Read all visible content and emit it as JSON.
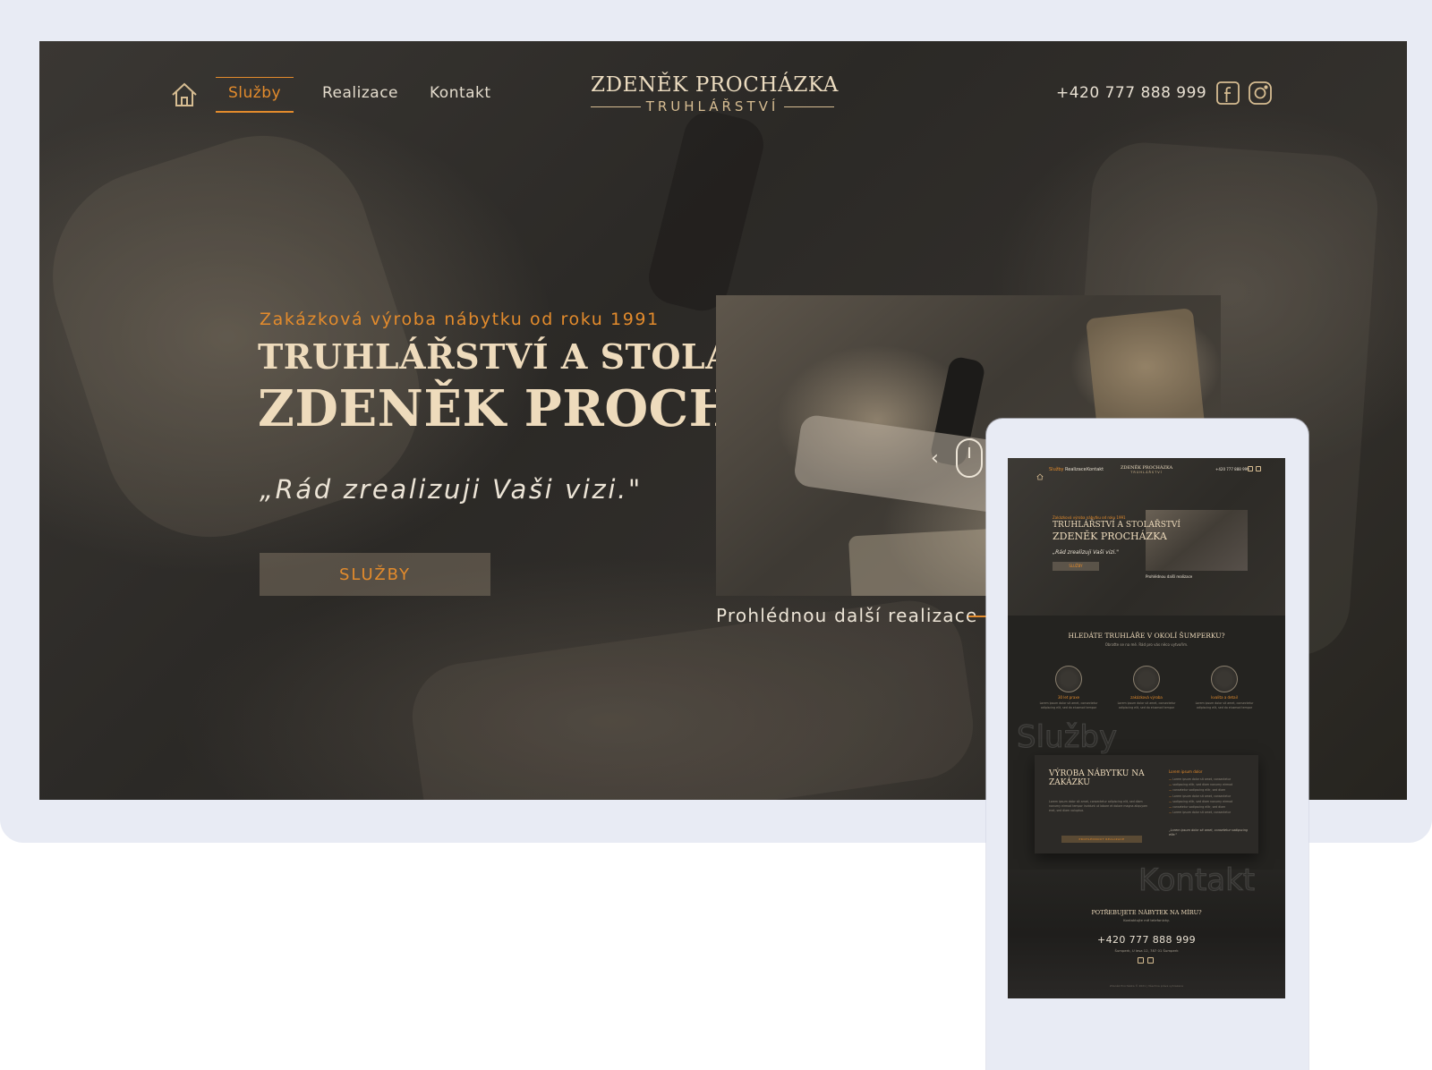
{
  "desktop": {
    "nav": {
      "home_icon": "home-icon",
      "links": [
        {
          "label": "Služby",
          "active": true
        },
        {
          "label": "Realizace",
          "active": false
        },
        {
          "label": "Kontakt",
          "active": false
        }
      ],
      "logo_name": "ZDENĚK PROCHÁZKA",
      "logo_sub": "TRUHLÁŘSTVÍ",
      "phone": "+420 777 888 999",
      "social_icons": [
        "facebook-icon",
        "instagram-icon"
      ]
    },
    "hero": {
      "eyebrow": "Zakázková výroba nábytku od roku 1991",
      "title_line1": "TRUHLÁŘSTVÍ A STOLAŘSTVÍ",
      "title_line2": "ZDENĚK PROCHÁZKA",
      "quote": "„Rád zrealizuji Vaši vizi.\"",
      "cta_label": "SLUŽBY",
      "realizace_link": "Prohlédnou další realizace"
    }
  },
  "mobile": {
    "nav": {
      "links": [
        "Služby",
        "Realizace",
        "Kontakt"
      ],
      "logo_name": "ZDENĚK PROCHÁZKA",
      "logo_sub": "TRUHLÁŘSTVÍ",
      "phone": "+420 777 888 999"
    },
    "hero": {
      "eyebrow": "Zakázková výroba nábytku od roku 1991",
      "title_line1": "TRUHLÁŘSTVÍ A STOLAŘSTVÍ",
      "title_line2": "ZDENĚK PROCHÁZKA",
      "quote": "„Rád zrealizuji Vaši vizi.\"",
      "cta_label": "SLUŽBY",
      "realizace_link": "Prohlédnou další realizace"
    },
    "intro": {
      "title": "HLEDÁTE TRUHLÁŘE V OKOLÍ ŠUMPERKU?",
      "subtitle": "Obraťte se na mě. Rád pro vás něco vytvořím."
    },
    "features": [
      {
        "icon": "saw-blade-icon",
        "label": "30 let praxe",
        "text": "Lorem ipsum dolor sit amet, consectetur adipiscing elit, sed do eiusmod tempor"
      },
      {
        "icon": "cabinet-icon",
        "label": "zakázková výroba",
        "text": "Lorem ipsum dolor sit amet, consectetur adipiscing elit, sed do eiusmod tempor"
      },
      {
        "icon": "tools-icon",
        "label": "kvalita a detail",
        "text": "Lorem ipsum dolor sit amet, consectetur adipiscing elit, sed do eiusmod tempor"
      }
    ],
    "services_watermark": "Služby",
    "service_card": {
      "title": "VÝROBA NÁBYTKU NA ZAKÁZKU",
      "text": "Lorem ipsum dolor sit amet, consectetur adipiscing elit, sed diam nonumy eirmod tempor invidunt ut labore et dolore magna aliquyam erat, sed diam voluptua.",
      "button": "PROHLÉDNOUT REALIZACE",
      "list_title": "Lorem ipsum dolor",
      "list": [
        "Lorem ipsum dolor sit amet, consectetur",
        "sadipscing elitr, sed diam nonumy eirmod",
        "consetetur sadipscing elitr, sed diam",
        "Lorem ipsum dolor sit amet, consectetur",
        "sadipscing elitr, sed diam nonumy eirmod",
        "consetetur sadipscing elitr, sed diam",
        "Lorem ipsum dolor sit amet, consectetur"
      ],
      "quote": "„Lorem ipsum dolor sit amet, consetetur sadipscing elitr.\""
    },
    "contact_watermark": "Kontakt",
    "contact": {
      "title": "POTŘEBUJETE NÁBYTEK NA MÍRU?",
      "subtitle": "Kontaktujte mě telefonicky.",
      "phone": "+420 777 888 999",
      "address": "Šumperk, U lesa 12, 787 01 Šumperk"
    },
    "footer": "Zdeněk Procházka © 2021 | Všechna práva vyhrazena"
  },
  "colors": {
    "accent": "#e38b2c",
    "gold": "#d7bd92",
    "cream": "#eedbbc",
    "frame": "#e8ebf4"
  }
}
